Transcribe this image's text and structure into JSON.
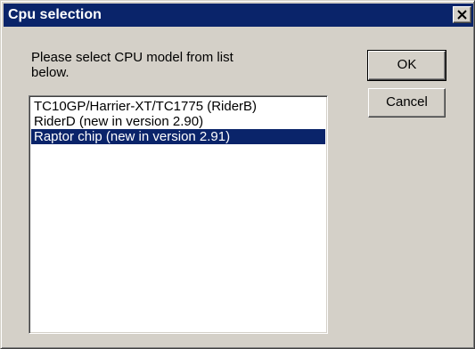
{
  "window": {
    "title": "Cpu selection"
  },
  "prompt": "Please select CPU model from list below.",
  "cpu_list": {
    "items": [
      {
        "label": "TC10GP/Harrier-XT/TC1775 (RiderB)",
        "selected": false
      },
      {
        "label": "RiderD (new in version 2.90)",
        "selected": false
      },
      {
        "label": "Raptor chip (new in version 2.91)",
        "selected": true
      }
    ]
  },
  "buttons": {
    "ok": "OK",
    "cancel": "Cancel"
  },
  "colors": {
    "face": "#d4d0c8",
    "titlebar": "#0a246a",
    "selection": "#0a246a"
  },
  "icons": {
    "close": "close-icon"
  }
}
